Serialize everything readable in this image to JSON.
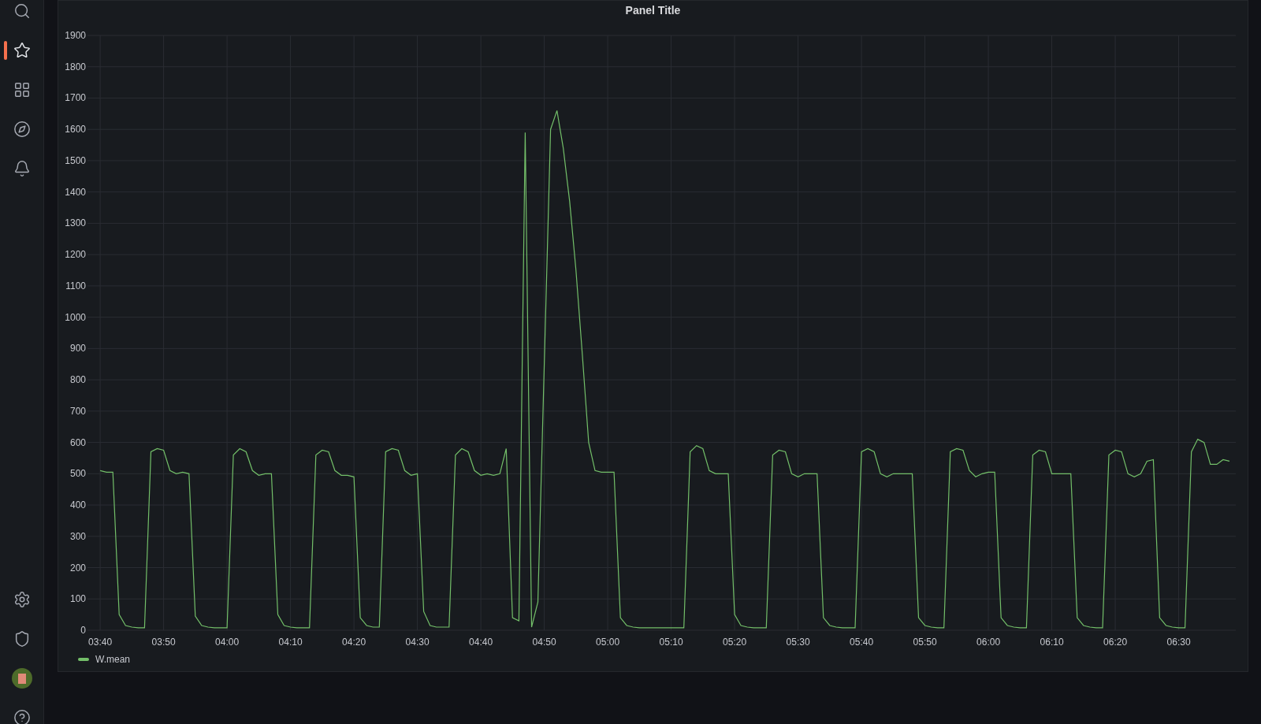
{
  "sidebar": {
    "items": [
      {
        "kind": "search",
        "selected": false
      },
      {
        "kind": "starred",
        "selected": true
      },
      {
        "kind": "dashboards",
        "selected": false
      },
      {
        "kind": "explore",
        "selected": false
      },
      {
        "kind": "alerting",
        "selected": false
      }
    ],
    "bottom_items": [
      {
        "kind": "settings"
      },
      {
        "kind": "shield"
      },
      {
        "kind": "avatar"
      },
      {
        "kind": "help"
      }
    ]
  },
  "panel": {
    "title": "Panel Title",
    "chart_data": {
      "type": "line",
      "categories": [
        "03:40",
        null,
        null,
        null,
        null,
        null,
        null,
        null,
        null,
        null,
        "03:50",
        null,
        null,
        null,
        null,
        null,
        null,
        null,
        null,
        null,
        "04:00",
        null,
        null,
        null,
        null,
        null,
        null,
        null,
        null,
        null,
        "04:10",
        null,
        null,
        null,
        null,
        null,
        null,
        null,
        null,
        null,
        "04:20",
        null,
        null,
        null,
        null,
        null,
        null,
        null,
        null,
        null,
        "04:30",
        null,
        null,
        null,
        null,
        null,
        null,
        null,
        null,
        null,
        "04:40",
        null,
        null,
        null,
        null,
        null,
        null,
        null,
        null,
        null,
        "04:50",
        null,
        null,
        null,
        null,
        null,
        null,
        null,
        null,
        null,
        "05:00",
        null,
        null,
        null,
        null,
        null,
        null,
        null,
        null,
        null,
        "05:10",
        null,
        null,
        null,
        null,
        null,
        null,
        null,
        null,
        null,
        "05:20",
        null,
        null,
        null,
        null,
        null,
        null,
        null,
        null,
        null,
        "05:30",
        null,
        null,
        null,
        null,
        null,
        null,
        null,
        null,
        null,
        "05:40",
        null,
        null,
        null,
        null,
        null,
        null,
        null,
        null,
        null,
        "05:50",
        null,
        null,
        null,
        null,
        null,
        null,
        null,
        null,
        null,
        "06:00",
        null,
        null,
        null,
        null,
        null,
        null,
        null,
        null,
        null,
        "06:10",
        null,
        null,
        null,
        null,
        null,
        null,
        null,
        null,
        null,
        "06:20",
        null,
        null,
        null,
        null,
        null,
        null,
        null,
        null,
        null,
        "06:30",
        null,
        null,
        null,
        null,
        null,
        null,
        null,
        null
      ],
      "series": [
        {
          "name": "W.mean",
          "color": "#73bf69",
          "values": [
            510,
            505,
            505,
            50,
            15,
            10,
            8,
            8,
            570,
            580,
            575,
            510,
            500,
            505,
            500,
            45,
            15,
            10,
            8,
            8,
            8,
            560,
            580,
            570,
            510,
            495,
            500,
            500,
            50,
            15,
            10,
            8,
            8,
            8,
            560,
            575,
            570,
            510,
            495,
            495,
            490,
            40,
            15,
            10,
            10,
            570,
            580,
            575,
            510,
            495,
            500,
            60,
            15,
            10,
            10,
            10,
            560,
            580,
            570,
            510,
            495,
            500,
            495,
            500,
            580,
            40,
            30,
            1590,
            10,
            90,
            850,
            1600,
            1660,
            1540,
            1370,
            1150,
            880,
            600,
            510,
            505,
            505,
            505,
            40,
            15,
            10,
            8,
            8,
            8,
            8,
            8,
            8,
            8,
            8,
            570,
            590,
            580,
            510,
            500,
            500,
            500,
            50,
            15,
            10,
            8,
            8,
            8,
            560,
            575,
            570,
            500,
            490,
            500,
            500,
            500,
            40,
            15,
            10,
            8,
            8,
            8,
            570,
            580,
            570,
            500,
            490,
            500,
            500,
            500,
            500,
            40,
            15,
            10,
            8,
            8,
            570,
            580,
            575,
            510,
            490,
            500,
            505,
            505,
            40,
            15,
            10,
            8,
            8,
            560,
            575,
            570,
            500,
            500,
            500,
            500,
            40,
            15,
            10,
            8,
            8,
            560,
            575,
            570,
            500,
            490,
            500,
            540,
            545,
            40,
            15,
            10,
            8,
            8,
            570,
            610,
            600,
            530,
            530,
            545,
            540
          ]
        }
      ],
      "ylim": [
        0,
        1900
      ],
      "grid": true,
      "yticks": [
        0,
        100,
        200,
        300,
        400,
        500,
        600,
        700,
        800,
        900,
        1000,
        1100,
        1200,
        1300,
        1400,
        1500,
        1600,
        1700,
        1800,
        1900
      ]
    }
  }
}
